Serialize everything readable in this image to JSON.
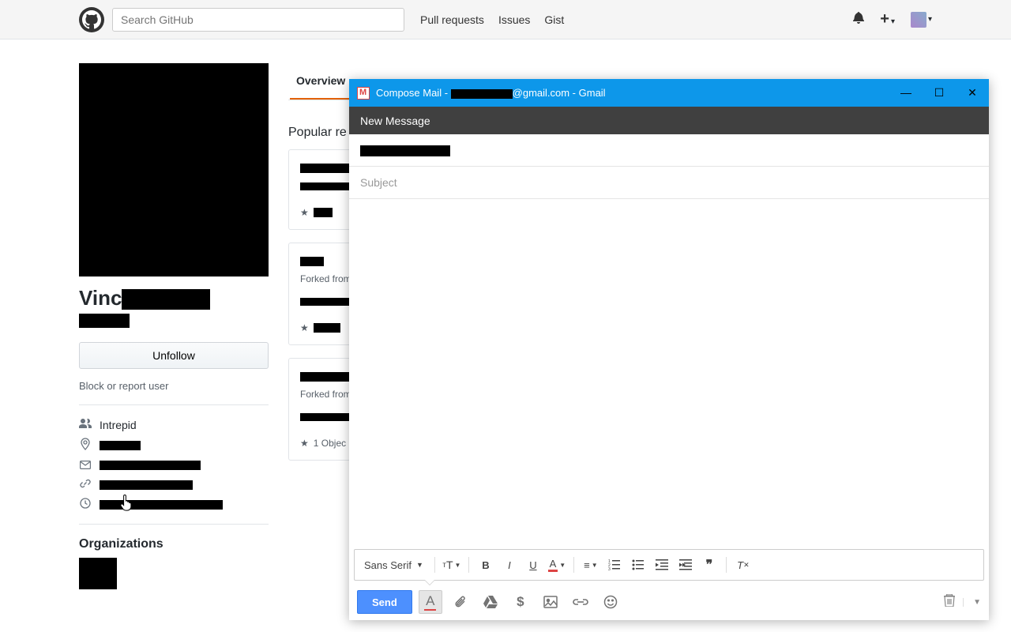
{
  "github": {
    "search_placeholder": "Search GitHub",
    "nav": {
      "pulls": "Pull requests",
      "issues": "Issues",
      "gist": "Gist"
    },
    "profile": {
      "name_prefix": "Vinc",
      "unfollow": "Unfollow",
      "block_report": "Block or report user",
      "company": "Intrepid",
      "organizations": "Organizations"
    },
    "tabs": {
      "overview": "Overview"
    },
    "popular_repos": "Popular re",
    "forked_from": "Forked from",
    "objc": "1 Objec"
  },
  "gmail": {
    "title_prefix": "Compose Mail - ",
    "title_suffix": "@gmail.com - Gmail",
    "new_message": "New Message",
    "subject_placeholder": "Subject",
    "font": "Sans Serif",
    "send": "Send"
  }
}
